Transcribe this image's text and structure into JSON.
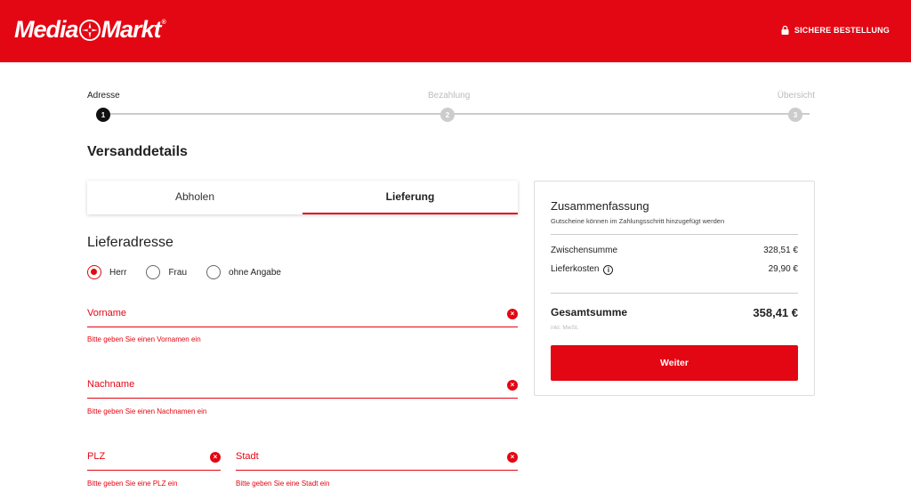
{
  "header": {
    "logo_text_left": "Media",
    "logo_text_right": "Markt",
    "logo_trademark": "®",
    "secure_label": "SICHERE BESTELLUNG",
    "brand_color": "#e30613"
  },
  "steps": [
    {
      "label": "Adresse",
      "number": "1",
      "active": true
    },
    {
      "label": "Bezahlung",
      "number": "2",
      "active": false
    },
    {
      "label": "Übersicht",
      "number": "3",
      "active": false
    }
  ],
  "shipping": {
    "title": "Versanddetails",
    "tabs": [
      {
        "label": "Abholen",
        "active": false
      },
      {
        "label": "Lieferung",
        "active": true
      }
    ]
  },
  "address": {
    "title": "Lieferadresse",
    "salutations": [
      {
        "label": "Herr",
        "checked": true
      },
      {
        "label": "Frau",
        "checked": false
      },
      {
        "label": "ohne Angabe",
        "checked": false
      }
    ],
    "fields": {
      "vorname": {
        "label": "Vorname",
        "error": "Bitte geben Sie einen Vornamen ein"
      },
      "nachname": {
        "label": "Nachname",
        "error": "Bitte geben Sie einen Nachnamen ein"
      },
      "plz": {
        "label": "PLZ",
        "error": "Bitte geben Sie eine PLZ ein"
      },
      "stadt": {
        "label": "Stadt",
        "error": "Bitte geben Sie eine Stadt ein"
      }
    },
    "error_icon": "×"
  },
  "summary": {
    "title": "Zusammenfassung",
    "subtitle": "Gutscheine können im Zahlungsschritt hinzugefügt werden",
    "subtotal_label": "Zwischensumme",
    "subtotal_value": "328,51 €",
    "shipping_label": "Lieferkosten",
    "shipping_value": "29,90 €",
    "info_icon": "i",
    "total_label": "Gesamtsumme",
    "total_value": "358,41 €",
    "vat_note": "inkl. MwSt.",
    "button_label": "Weiter"
  }
}
